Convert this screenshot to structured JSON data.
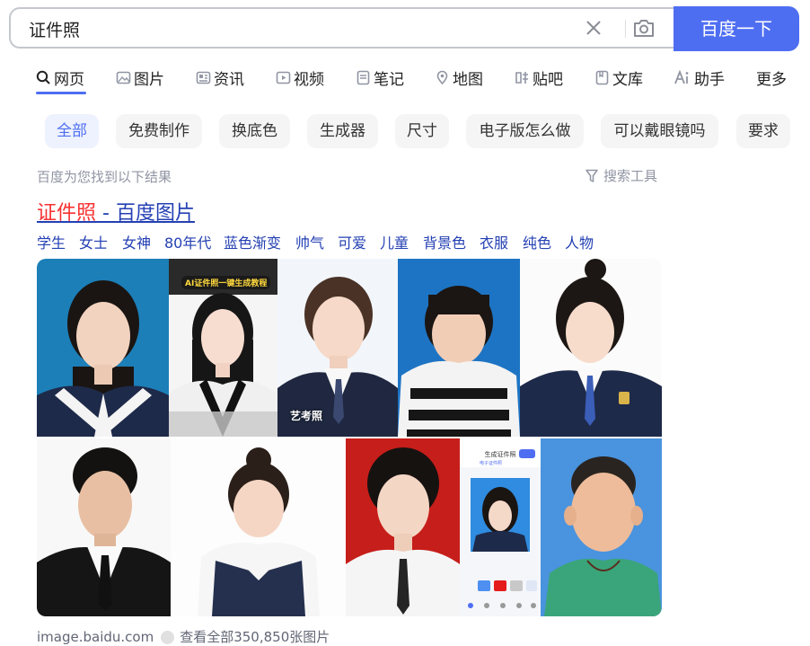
{
  "search": {
    "query": "证件照",
    "button_label": "百度一下"
  },
  "tabs": [
    {
      "label": "网页",
      "icon": "search-icon"
    },
    {
      "label": "图片",
      "icon": "image-icon"
    },
    {
      "label": "资讯",
      "icon": "news-icon"
    },
    {
      "label": "视频",
      "icon": "video-icon"
    },
    {
      "label": "笔记",
      "icon": "note-icon"
    },
    {
      "label": "地图",
      "icon": "map-pin-icon"
    },
    {
      "label": "贴吧",
      "icon": "tieba-icon"
    },
    {
      "label": "文库",
      "icon": "library-icon"
    },
    {
      "label": "助手",
      "icon": "ai-icon"
    },
    {
      "label": "更多",
      "icon": ""
    }
  ],
  "chips": [
    "全部",
    "免费制作",
    "换底色",
    "生成器",
    "尺寸",
    "电子版怎么做",
    "可以戴眼镜吗",
    "要求"
  ],
  "result_count": "百度为您找到以下结果",
  "tools_label": "搜索工具",
  "result": {
    "title_highlight": "证件照",
    "title_rest": " - 百度图片",
    "related": [
      "学生",
      "女士",
      "女神",
      "80年代",
      "蓝色渐变",
      "帅气",
      "可爱",
      "儿童",
      "背景色",
      "衣服",
      "纯色",
      "人物"
    ],
    "overlay_banner": "AI证件照一键生成教程",
    "overlay_art": "艺考照",
    "phone_title": "生成证件照",
    "phone_sub": "电子证件照",
    "source": "image.baidu.com",
    "more": "查看全部350,850张图片"
  },
  "colors": {
    "accent": "#4e6ef2",
    "link": "#2440b3",
    "highlight": "#f73131"
  }
}
